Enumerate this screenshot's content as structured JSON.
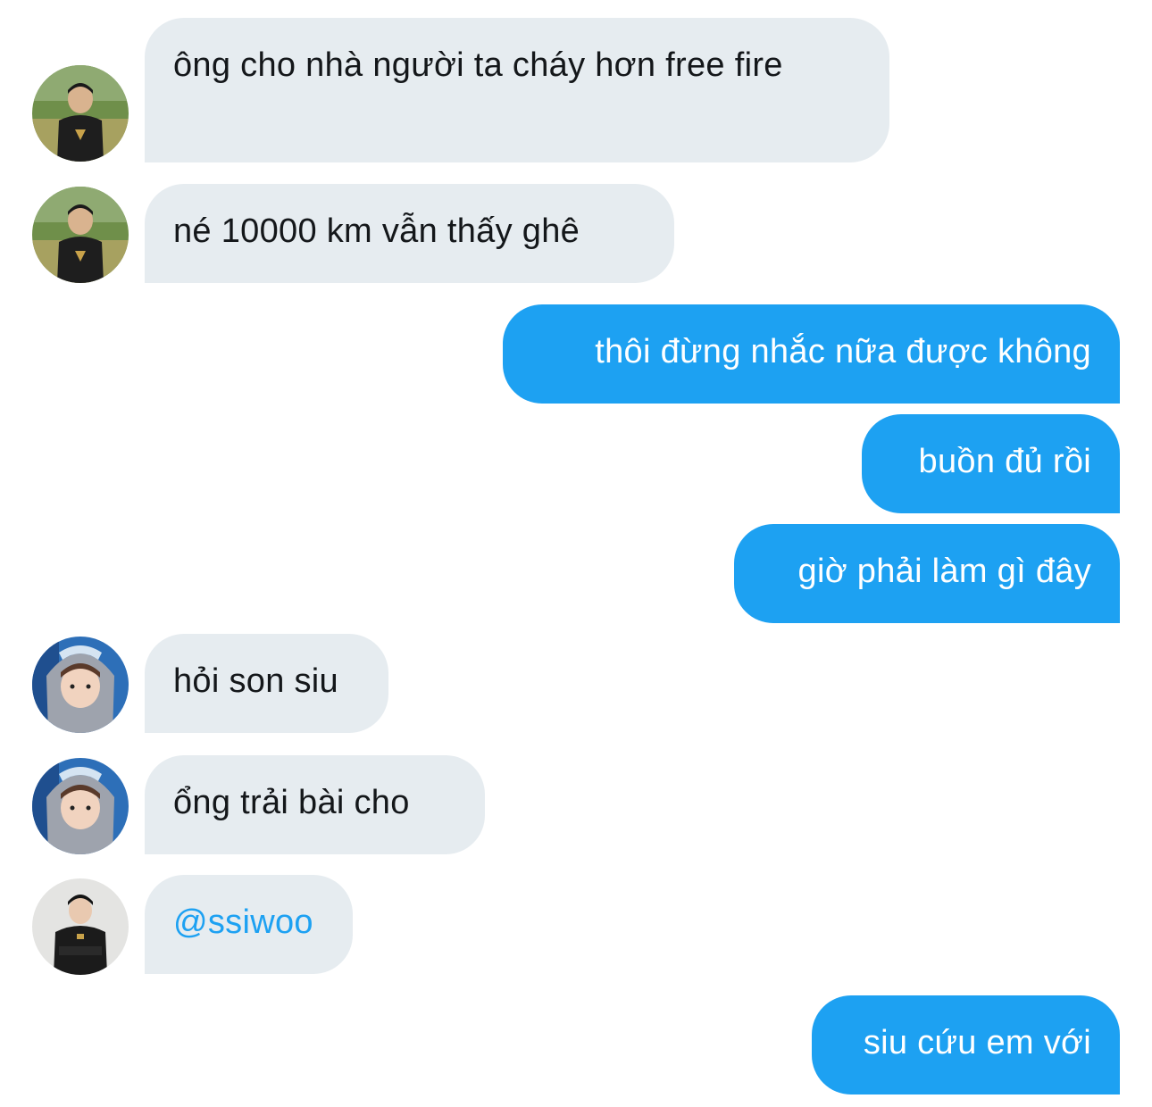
{
  "conversation": {
    "messages": [
      {
        "from": "other",
        "sender_avatar": "player-avatar-field-icon",
        "text": "ông cho nhà người ta cháy hơn free fire"
      },
      {
        "from": "other",
        "sender_avatar": "player-avatar-field-icon",
        "text": "né 10000 km vẫn thấy ghê"
      },
      {
        "from": "me",
        "text": "thôi đừng nhắc nữa được không"
      },
      {
        "from": "me",
        "text": "buồn đủ rồi"
      },
      {
        "from": "me",
        "text": "giờ phải làm gì đây"
      },
      {
        "from": "other",
        "sender_avatar": "player-avatar-hood-icon",
        "text": "hỏi son siu"
      },
      {
        "from": "other",
        "sender_avatar": "player-avatar-hood-icon",
        "text": "ổng trải bài cho"
      },
      {
        "from": "other",
        "sender_avatar": "player-avatar-studio-icon",
        "text": "@ssiwoo"
      },
      {
        "from": "me",
        "text": "siu cứu em với"
      }
    ]
  },
  "colors": {
    "incoming_bubble": "#e6ecf0",
    "outgoing_bubble": "#1da1f2",
    "incoming_text": "#14171a",
    "mention_text": "#1da1f2",
    "outgoing_text": "#ffffff"
  }
}
